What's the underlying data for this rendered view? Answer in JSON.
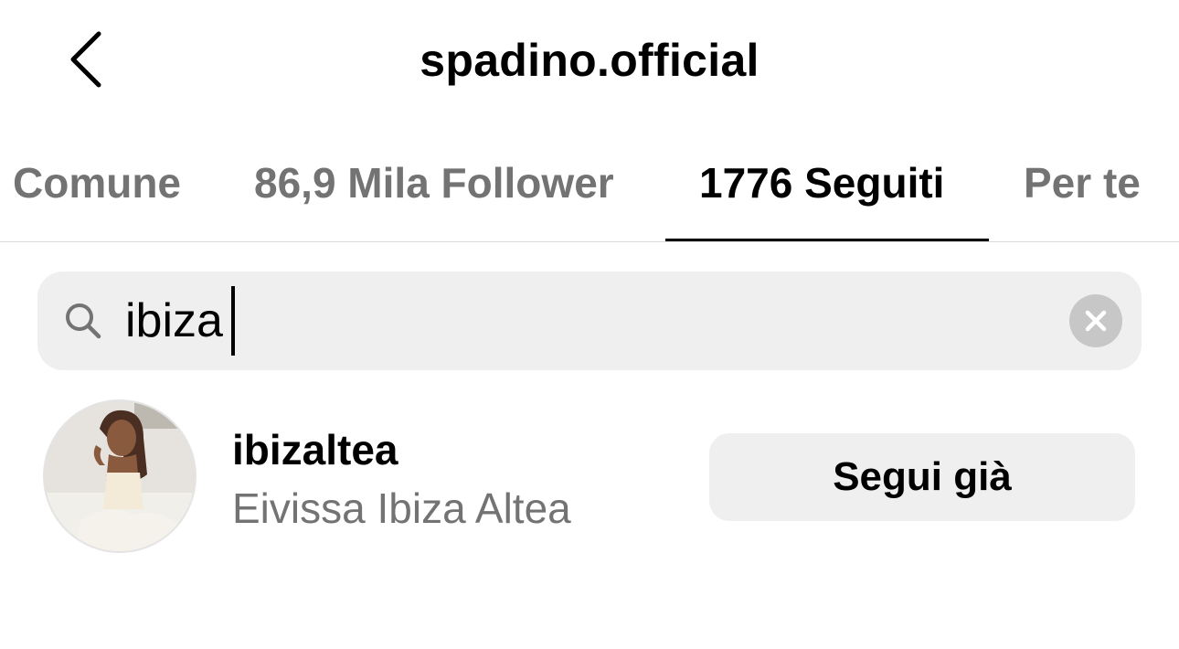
{
  "header": {
    "title": "spadino.official",
    "back_icon": "chevron-left-icon"
  },
  "tabs": [
    {
      "label": "Comune",
      "active": false
    },
    {
      "label": "86,9 Mila Follower",
      "active": false
    },
    {
      "label": "1776 Seguiti",
      "active": true
    },
    {
      "label": "Per te",
      "active": false
    }
  ],
  "search": {
    "value": "ibiza",
    "placeholder": "",
    "search_icon": "search-icon",
    "clear_icon": "clear-icon"
  },
  "results": [
    {
      "username": "ibizaltea",
      "full_name": "Eivissa Ibiza Altea",
      "button_label": "Segui già",
      "avatar": "avatar-photo"
    }
  ],
  "colors": {
    "text_primary": "#000000",
    "text_secondary": "#737373",
    "surface": "#efefef",
    "divider": "#dbdbdb",
    "clear_button": "#c7c7c7"
  }
}
